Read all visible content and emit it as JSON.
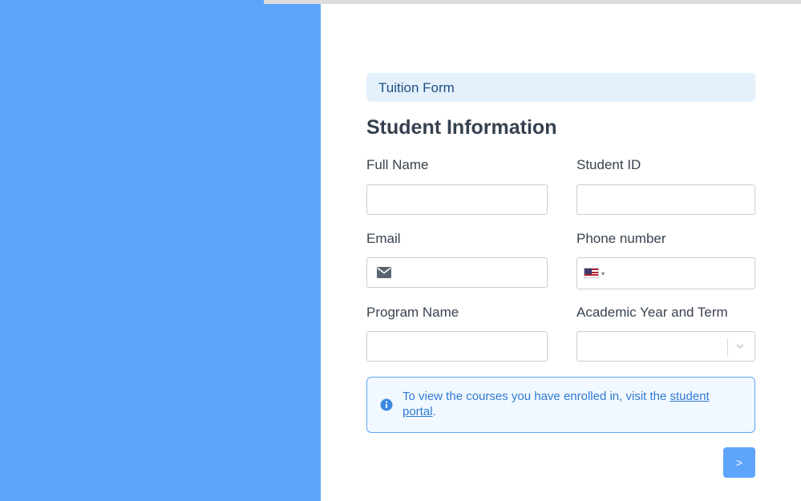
{
  "form": {
    "header": "Tuition Form",
    "section_title": "Student Information",
    "fields": {
      "full_name": {
        "label": "Full Name",
        "value": "",
        "placeholder": ""
      },
      "student_id": {
        "label": "Student ID",
        "value": "",
        "placeholder": ""
      },
      "email": {
        "label": "Email",
        "value": "",
        "placeholder": "",
        "icon": "envelope-icon"
      },
      "phone": {
        "label": "Phone number",
        "value": "",
        "placeholder": "",
        "country_flag": "us-flag-icon"
      },
      "program_name": {
        "label": "Program Name",
        "value": "",
        "placeholder": ""
      },
      "academic_term": {
        "label": "Academic Year and Term",
        "selected": ""
      }
    },
    "info": {
      "icon": "info-circle-icon",
      "text_before": "To view the courses you have enrolled in, visit the ",
      "link_text": "student portal",
      "text_after": "."
    },
    "next_label": ">"
  },
  "colors": {
    "accent": "#5fa4fb",
    "header_band": "#e4f1fd",
    "info_text": "#2f7ad3"
  }
}
